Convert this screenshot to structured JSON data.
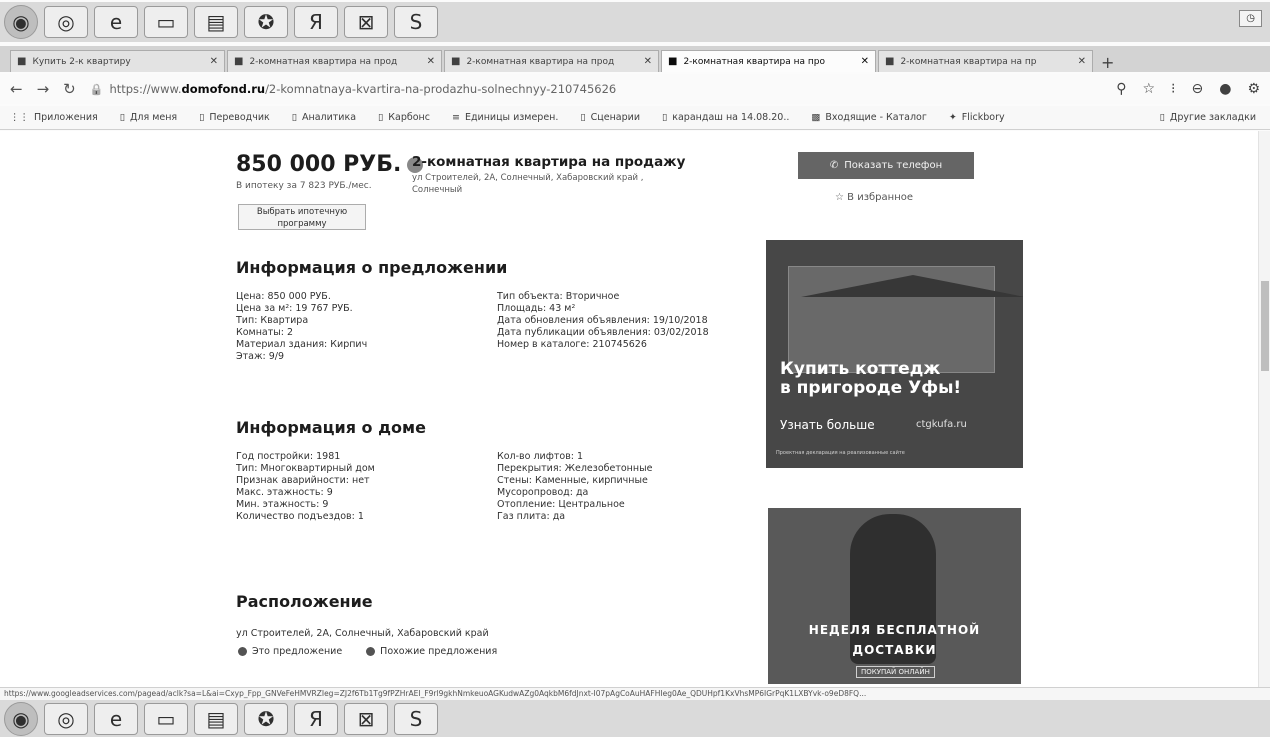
{
  "browser": {
    "tabs": [
      {
        "label": "Купить 2-к квартиру",
        "active": false
      },
      {
        "label": "2-комнатная квартира на прод",
        "active": false
      },
      {
        "label": "2-комнатная квартира на прод",
        "active": false
      },
      {
        "label": "2-комнатная квартира на про",
        "active": true
      },
      {
        "label": "2-комнатная квартира на пр",
        "active": false
      }
    ],
    "url_prefix": "https://www.",
    "url_domain": "domofond.ru",
    "url_path": "/2-komnatnaya-kvartira-na-prodazhu-solnechnyy-210745626",
    "bookmarks": [
      "Приложения",
      "Для меня",
      "Переводчик",
      "Аналитика",
      "Карбонс",
      "Единицы измерен.",
      "Сценарии",
      "карандаш на 14.08.20..",
      "Входящие - Каталог",
      "Flickbory"
    ],
    "bookmarks_other": "Другие закладки"
  },
  "listing": {
    "price": "850 000 РУБ.",
    "mortgage": "В ипотеку за 7 823 РУБ./мес.",
    "program_button": "Выбрать ипотечную программу",
    "title": "2-комнатная квартира на продажу",
    "address_small": "ул Строителей, 2А, Солнечный, Хабаровский край , Солнечный",
    "contact_button": "Показать телефон",
    "favorite": "В избранное"
  },
  "offer": {
    "heading": "Информация о предложении",
    "left": [
      "Цена: 850 000 РУБ.",
      "Цена за м²: 19 767 РУБ.",
      "Тип: Квартира",
      "Комнаты: 2",
      "Материал здания: Кирпич",
      "Этаж: 9/9"
    ],
    "right": [
      "Тип объекта: Вторичное",
      "Площадь: 43 м²",
      "Дата обновления объявления: 19/10/2018",
      "Дата публикации объявления: 03/02/2018",
      "Номер в каталоге: 210745626"
    ]
  },
  "house": {
    "heading": "Информация о доме",
    "left": [
      "Год постройки: 1981",
      "Тип: Многоквартирный дом",
      "Признак аварийности: нет",
      "Макс. этажность: 9",
      "Мин. этажность: 9",
      "Количество подъездов: 1"
    ],
    "right": [
      "Кол-во лифтов: 1",
      "Перекрытия: Железобетонные",
      "Стены: Каменные, кирпичные",
      "Мусоропровод: да",
      "Отопление: Центральное",
      "Газ плита: да"
    ]
  },
  "location": {
    "heading": "Расположение",
    "address": "ул Строителей, 2А, Солнечный, Хабаровский край",
    "legend_this": "Это предложение",
    "legend_similar": "Похожие предложения"
  },
  "ads": {
    "ad1_line1": "Купить коттедж",
    "ad1_line2": "в пригороде Уфы!",
    "ad1_more": "Узнать больше",
    "ad1_site": "ctgkufa.ru",
    "ad1_fine": "Проектная декларация на реализованные сайте",
    "ad2_line1": "НЕДЕЛЯ БЕСПЛАТНОЙ",
    "ad2_line2": "ДОСТАВКИ",
    "ad2_cta": "ПОКУПАЙ ОНЛАЙН"
  },
  "status_url": "https://www.googleadservices.com/pagead/aclk?sa=L&ai=Cxyp_Fpp_GNVeFeHMVRZIeg=ZJ2f6Tb1Tg9fPZHrAEI_F9rl9gkhNmkeuoAGKudwAZg0AqkbM6fdJnxt-I07pAgCoAuHAFHIeg0Ae_QDUHpf1KxVhsMP6IGrPqK1LXBYvk-o9eD8FQ..."
}
